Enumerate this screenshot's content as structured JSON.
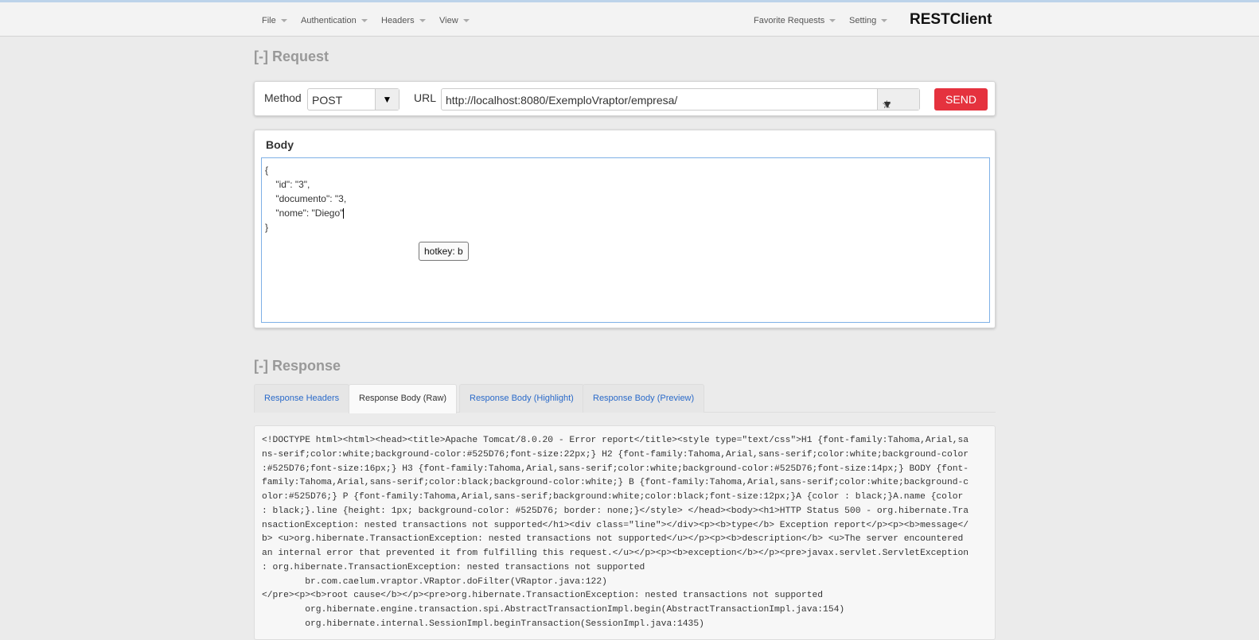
{
  "nav": {
    "left": [
      "File",
      "Authentication",
      "Headers",
      "View"
    ],
    "right": [
      "Favorite Requests",
      "Setting"
    ],
    "brand": "RESTClient"
  },
  "request": {
    "title": "[-] Request",
    "method_label": "Method",
    "method": "POST",
    "url_label": "URL",
    "url": "http://localhost:8080/ExemploVraptor/empresa/",
    "send": "SEND",
    "star_icon": "★",
    "chevron": "❯"
  },
  "body": {
    "title": "Body",
    "content": "{\n    \"id\": \"3\",\n    \"documento\": \"3,\n    \"nome\": \"Diego\"",
    "closing": "\n}",
    "tooltip": "hotkey: b"
  },
  "response": {
    "title": "[-] Response",
    "tabs": [
      "Response Headers",
      "Response Body (Raw)",
      "Response Body (Highlight)",
      "Response Body (Preview)"
    ],
    "active_tab": 1,
    "lines": [
      "<!DOCTYPE html><html><head><title>Apache Tomcat/8.0.20 - Error report</title><style type=\"text/css\">H1 {font-family:Tahoma,Arial,sa",
      "ns-serif;color:white;background-color:#525D76;font-size:22px;} H2 {font-family:Tahoma,Arial,sans-serif;color:white;background-color",
      ":#525D76;font-size:16px;} H3 {font-family:Tahoma,Arial,sans-serif;color:white;background-color:#525D76;font-size:14px;} BODY {font-",
      "family:Tahoma,Arial,sans-serif;color:black;background-color:white;} B {font-family:Tahoma,Arial,sans-serif;color:white;background-c",
      "olor:#525D76;} P {font-family:Tahoma,Arial,sans-serif;background:white;color:black;font-size:12px;}A {color : black;}A.name {color",
      ": black;}.line {height: 1px; background-color: #525D76; border: none;}</style> </head><body><h1>HTTP Status 500 - org.hibernate.Tra",
      "nsactionException: nested transactions not supported</h1><div class=\"line\"></div><p><b>type</b> Exception report</p><p><b>message</",
      "b> <u>org.hibernate.TransactionException: nested transactions not supported</u></p><p><b>description</b> <u>The server encountered",
      "an internal error that prevented it from fulfilling this request.</u></p><p><b>exception</b></p><pre>javax.servlet.ServletException",
      ": org.hibernate.TransactionException: nested transactions not supported",
      "        br.com.caelum.vraptor.VRaptor.doFilter(VRaptor.java:122)",
      "</pre><p><b>root cause</b></p><pre>org.hibernate.TransactionException: nested transactions not supported",
      "        org.hibernate.engine.transaction.spi.AbstractTransactionImpl.begin(AbstractTransactionImpl.java:154)",
      "        org.hibernate.internal.SessionImpl.beginTransaction(SessionImpl.java:1435)"
    ]
  }
}
